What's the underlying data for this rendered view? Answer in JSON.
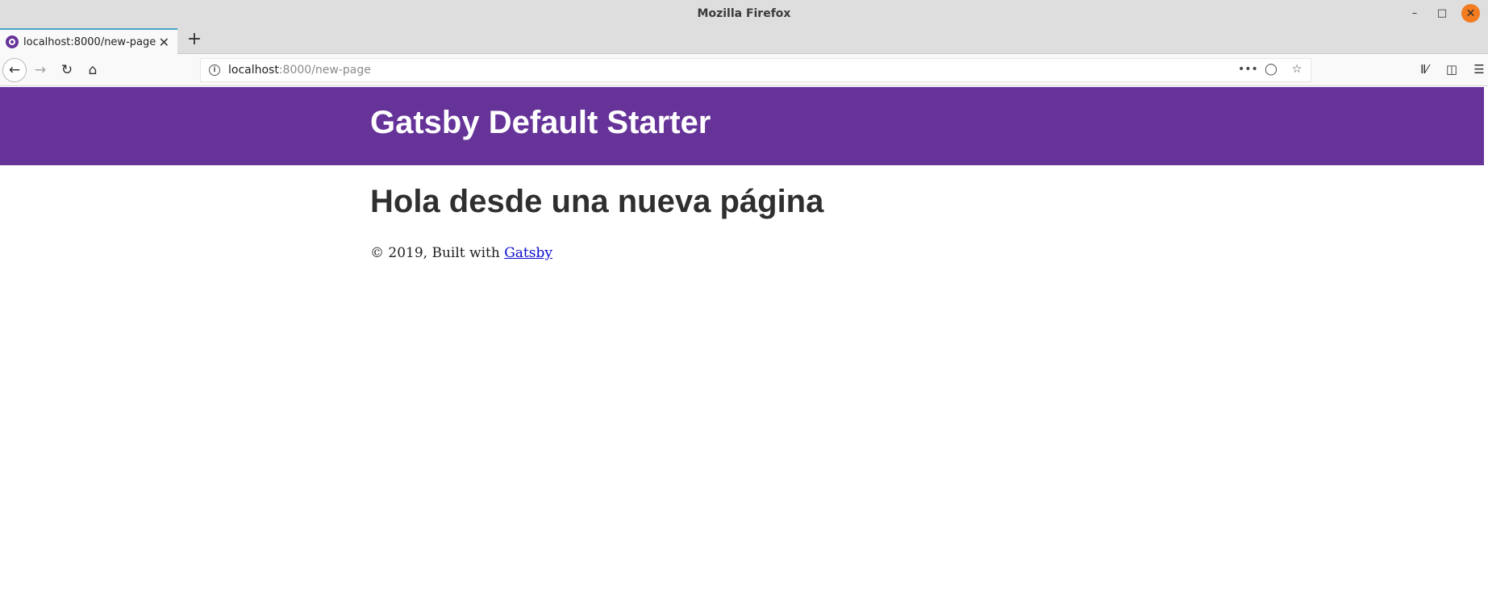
{
  "window": {
    "title": "Mozilla Firefox"
  },
  "tab": {
    "title": "localhost:8000/new-page"
  },
  "urlbar": {
    "host": "localhost",
    "path": ":8000/new-page"
  },
  "site": {
    "header_title": "Gatsby Default Starter",
    "page_heading": "Hola desde una nueva página",
    "footer_prefix": "© 2019, Built with ",
    "footer_link": "Gatsby"
  },
  "colors": {
    "header_bg": "#663399",
    "tab_accent": "#4aa3c4",
    "close_button": "#f27c1f"
  }
}
